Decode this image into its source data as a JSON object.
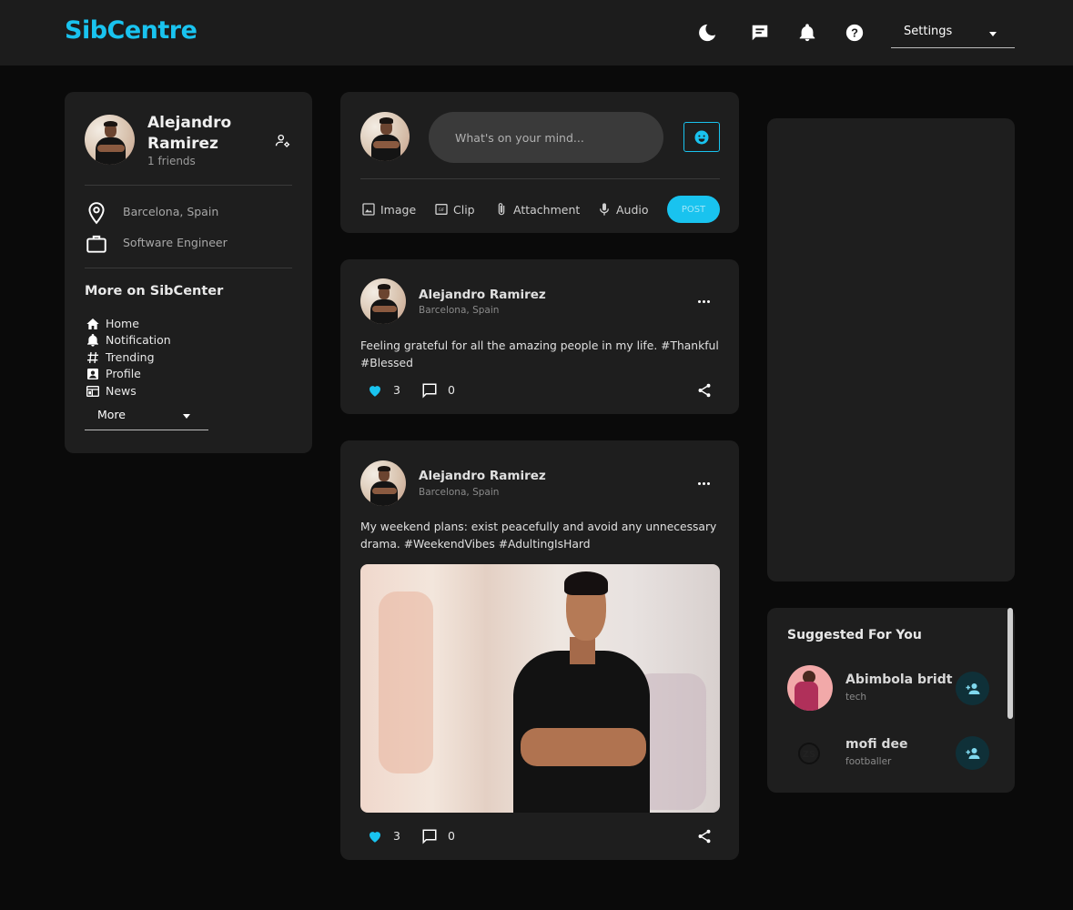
{
  "header": {
    "logo": "SibCentre",
    "settings_label": "Settings"
  },
  "profile": {
    "name": "Alejandro Ramirez",
    "friends": "1 friends",
    "location": "Barcelona, Spain",
    "occupation": "Software Engineer"
  },
  "more_section": {
    "title": "More on SibCenter",
    "items": [
      {
        "label": "Home",
        "icon": "home-icon"
      },
      {
        "label": "Notification",
        "icon": "bell-icon"
      },
      {
        "label": "Trending",
        "icon": "hashtag-icon"
      },
      {
        "label": "Profile",
        "icon": "profile-icon"
      },
      {
        "label": "News",
        "icon": "news-icon"
      }
    ],
    "more_label": "More"
  },
  "composer": {
    "placeholder": "What's on your mind...",
    "actions": [
      {
        "label": "Image",
        "icon": "image-icon"
      },
      {
        "label": "Clip",
        "icon": "gif-icon"
      },
      {
        "label": "Attachment",
        "icon": "paperclip-icon"
      },
      {
        "label": "Audio",
        "icon": "microphone-icon"
      }
    ],
    "post_label": "POST"
  },
  "posts": [
    {
      "author": "Alejandro Ramirez",
      "location": "Barcelona, Spain",
      "text": "Feeling grateful for all the amazing people in my life. #Thankful #Blessed",
      "likes": "3",
      "comments": "0"
    },
    {
      "author": "Alejandro Ramirez",
      "location": "Barcelona, Spain",
      "text": "My weekend plans: exist peacefully and avoid any unnecessary drama. #WeekendVibes #AdultingIsHard",
      "likes": "3",
      "comments": "0"
    }
  ],
  "suggested": {
    "title": "Suggested For You",
    "users": [
      {
        "name": "Abimbola bridt",
        "subtitle": "tech"
      },
      {
        "name": "mofi dee",
        "subtitle": "footballer"
      }
    ]
  },
  "colors": {
    "accent": "#19c3ef",
    "background": "#0a0a0a",
    "card": "#1e1e1e",
    "topbar": "#1c1c1c"
  }
}
